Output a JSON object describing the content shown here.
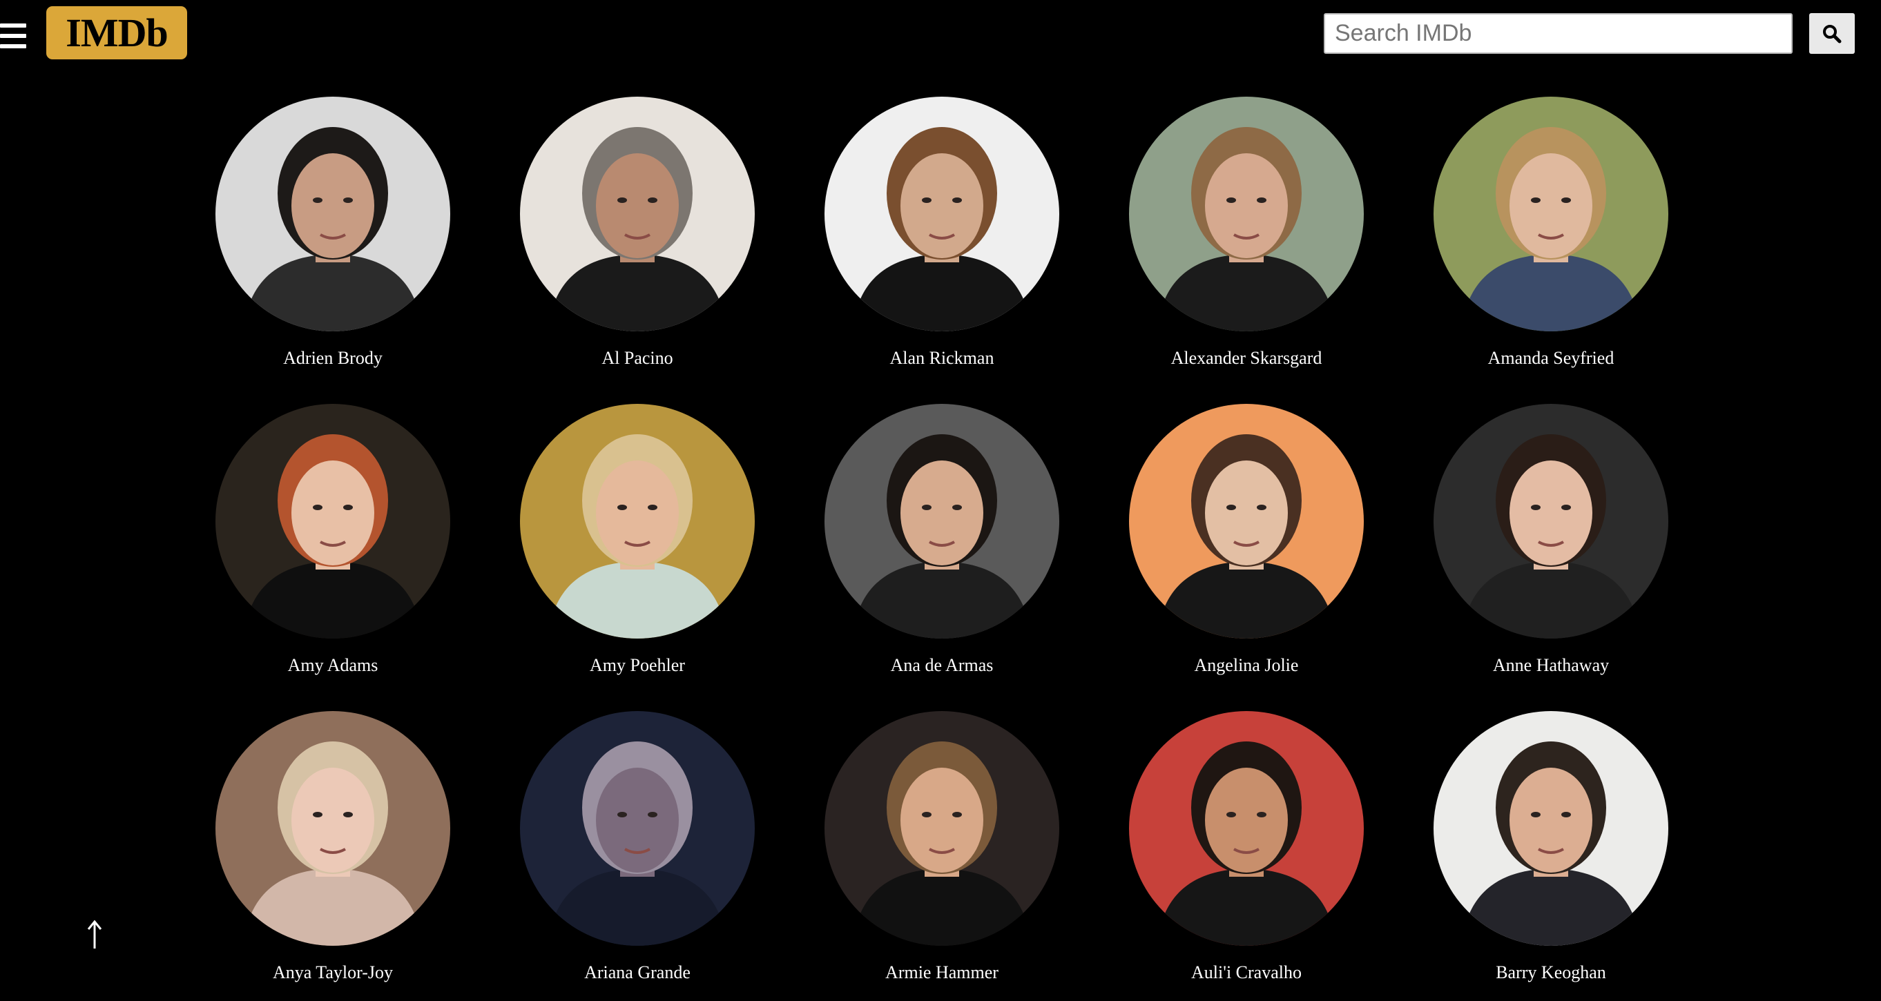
{
  "header": {
    "logo_text": "IMDb",
    "search_placeholder": "Search IMDb",
    "search_value": "",
    "menu_icon": "hamburger-menu-icon",
    "search_icon": "magnifier-search-icon"
  },
  "actors": [
    {
      "name": "Adrien Brody",
      "bg": "#d9d9d9",
      "skin": "#c89c83",
      "hair": "#1d1a18",
      "top": "#2c2c2c"
    },
    {
      "name": "Al Pacino",
      "bg": "#e7e2dc",
      "skin": "#b98a70",
      "hair": "#7c7670",
      "top": "#1a1a1a"
    },
    {
      "name": "Alan Rickman",
      "bg": "#efefef",
      "skin": "#d2a98c",
      "hair": "#7a4f2f",
      "top": "#141414"
    },
    {
      "name": "Alexander Skarsgard",
      "bg": "#8fa08a",
      "skin": "#d6a98f",
      "hair": "#8e6a46",
      "top": "#1b1b1b"
    },
    {
      "name": "Amanda Seyfried",
      "bg": "#8e9b5c",
      "skin": "#e0b99e",
      "hair": "#b8935e",
      "top": "#3b4b6a"
    },
    {
      "name": "Amy Adams",
      "bg": "#2a241d",
      "skin": "#e8c0a6",
      "hair": "#b4542e",
      "top": "#0f0f0f"
    },
    {
      "name": "Amy Poehler",
      "bg": "#b9963e",
      "skin": "#e5b99b",
      "hair": "#d9c18f",
      "top": "#c8d8cf"
    },
    {
      "name": "Ana de Armas",
      "bg": "#5a5a5a",
      "skin": "#d7ab8e",
      "hair": "#1b1613",
      "top": "#1e1e1e"
    },
    {
      "name": "Angelina Jolie",
      "bg": "#ef9a5d",
      "skin": "#e3bfa4",
      "hair": "#4a3022",
      "top": "#171717"
    },
    {
      "name": "Anne Hathaway",
      "bg": "#2c2c2c",
      "skin": "#e4bca4",
      "hair": "#2a1d17",
      "top": "#202020"
    },
    {
      "name": "Anya Taylor-Joy",
      "bg": "#8f6f5b",
      "skin": "#ecc9b7",
      "hair": "#d6c2a5",
      "top": "#d2b7a9"
    },
    {
      "name": "Ariana Grande",
      "bg": "#1d2338",
      "skin": "#7b6a7c",
      "hair": "#9a90a0",
      "top": "#161b2c"
    },
    {
      "name": "Armie Hammer",
      "bg": "#2a2322",
      "skin": "#d8a888",
      "hair": "#7b5a3a",
      "top": "#111111"
    },
    {
      "name": "Auli'i Cravalho",
      "bg": "#c7413a",
      "skin": "#c88f6c",
      "hair": "#1f1612",
      "top": "#161616"
    },
    {
      "name": "Barry Keoghan",
      "bg": "#ececea",
      "skin": "#dcae92",
      "hair": "#2d241e",
      "top": "#24242a"
    }
  ],
  "scroll_top_icon": "up-arrow-icon"
}
